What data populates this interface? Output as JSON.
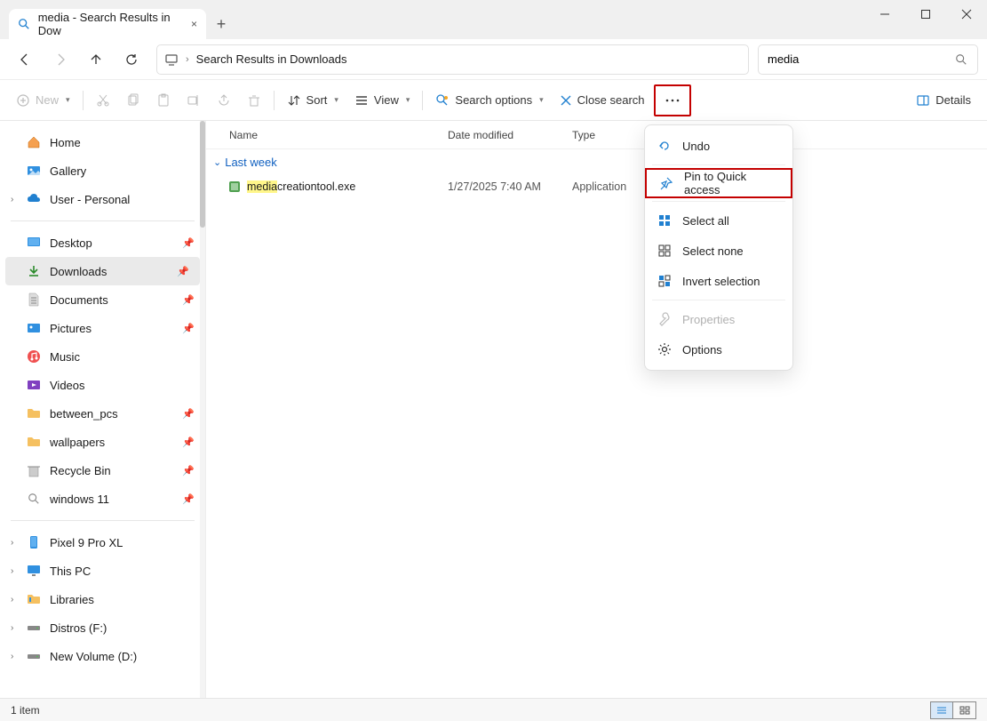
{
  "titlebar": {
    "tab_title": "media - Search Results in Dow",
    "close": "×",
    "newtab": "+"
  },
  "addressbar": {
    "path": "Search Results in Downloads"
  },
  "search": {
    "value": "media"
  },
  "toolbar": {
    "new": "New",
    "sort": "Sort",
    "view": "View",
    "search_options": "Search options",
    "close_search": "Close search",
    "details": "Details"
  },
  "sidebar": {
    "home": "Home",
    "gallery": "Gallery",
    "user": "User - Personal",
    "desktop": "Desktop",
    "downloads": "Downloads",
    "documents": "Documents",
    "pictures": "Pictures",
    "music": "Music",
    "videos": "Videos",
    "between_pcs": "between_pcs",
    "wallpapers": "wallpapers",
    "recycle": "Recycle Bin",
    "windows11": "windows 11",
    "pixel": "Pixel 9 Pro XL",
    "thispc": "This PC",
    "libraries": "Libraries",
    "distros": "Distros (F:)",
    "newvol": "New Volume (D:)"
  },
  "columns": {
    "name": "Name",
    "date": "Date modified",
    "type": "Type"
  },
  "group": "Last week",
  "file": {
    "name_pre": "media",
    "name_rest": "creationtool.exe",
    "date": "1/27/2025 7:40 AM",
    "type": "Application"
  },
  "menu": {
    "undo": "Undo",
    "pin": "Pin to Quick access",
    "select_all": "Select all",
    "select_none": "Select none",
    "invert": "Invert selection",
    "properties": "Properties",
    "options": "Options"
  },
  "status": {
    "count": "1 item"
  }
}
